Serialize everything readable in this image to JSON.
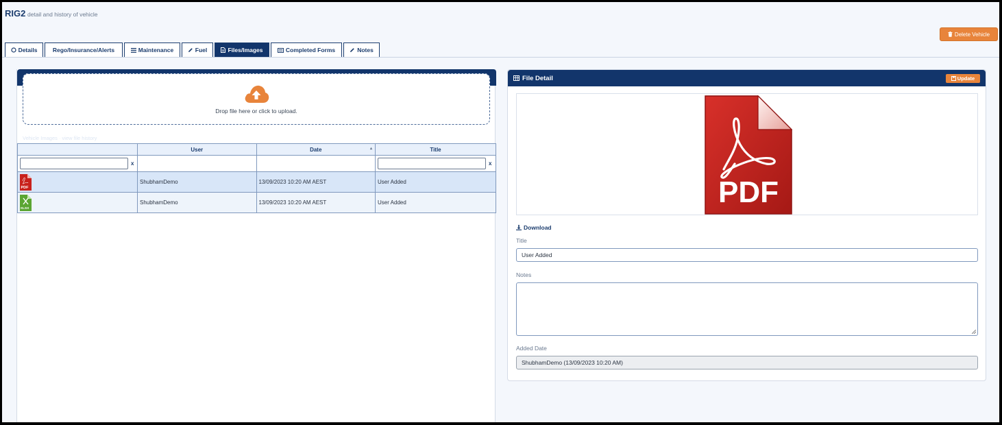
{
  "header": {
    "title": "RIG2",
    "subtitle": "detail and history of vehicle",
    "delete_label": "Delete Vehicle"
  },
  "tabs": [
    {
      "label": "Details",
      "icon": "circle-icon",
      "active": false
    },
    {
      "label": "Rego/Insurance/Alerts",
      "icon": "",
      "active": false
    },
    {
      "label": "Maintenance",
      "icon": "list-icon",
      "active": false
    },
    {
      "label": "Fuel",
      "icon": "pencil-icon",
      "active": false
    },
    {
      "label": "Files/Images",
      "icon": "file-icon",
      "active": true
    },
    {
      "label": "Completed Forms",
      "icon": "card-icon",
      "active": false
    },
    {
      "label": "Notes",
      "icon": "pencil-icon",
      "active": false
    }
  ],
  "upload": {
    "text": "Drop file here or click to upload.",
    "icon": "cloud-upload-icon",
    "accent": "#e8843b"
  },
  "faint_line": {
    "text": "Vehicle Images",
    "link": "view file history"
  },
  "table": {
    "columns": [
      "",
      "User",
      "Date",
      "Title"
    ],
    "filter_clear": "x",
    "rows": [
      {
        "icon": "pdf-file-icon",
        "icon_text": "PDF",
        "user": "ShubhamDemo",
        "date": "13/09/2023 10:20 AM AEST",
        "title": "User Added",
        "selected": true
      },
      {
        "icon": "xlsx-file-icon",
        "icon_text": "XLSX",
        "user": "ShubhamDemo",
        "date": "13/09/2023 10:20 AM AEST",
        "title": "User Added",
        "selected": false
      }
    ]
  },
  "detail": {
    "heading": "File Detail",
    "update_label": "Update",
    "preview_icon": "pdf-document-icon",
    "preview_text": "PDF",
    "download_label": "Download",
    "title_label": "Title",
    "title_value": "User Added",
    "notes_label": "Notes",
    "notes_value": "",
    "added_label": "Added Date",
    "added_value": "ShubhamDemo (13/09/2023 10:20 AM)"
  },
  "colors": {
    "primary": "#12356b",
    "accent": "#e8843b",
    "pdf_red": "#c8211c",
    "xlsx_green": "#5aa532"
  }
}
